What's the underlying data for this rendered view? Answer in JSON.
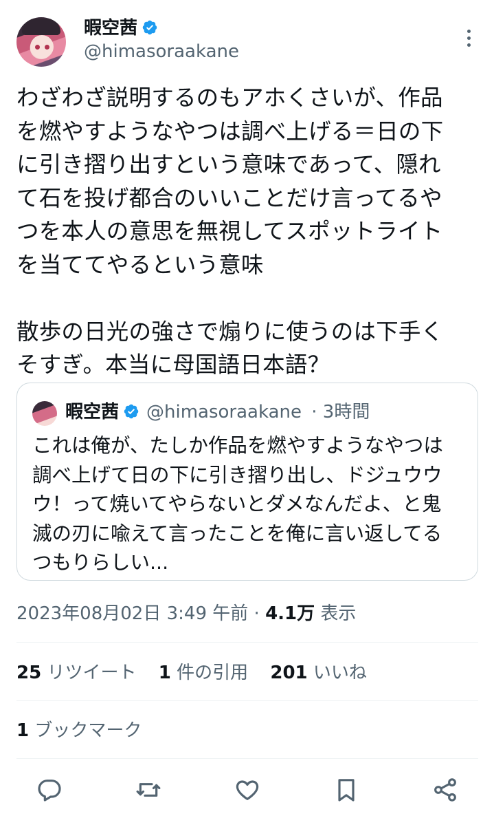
{
  "author": {
    "display_name": "暇空茜",
    "handle": "@himasoraakane",
    "verified_badge_color": "#1d9bf0",
    "avatar_icon": "anime-girl-avatar"
  },
  "tweet": {
    "text": "わざわざ説明するのもアホくさいが、作品\nを燃やすようなやつは調べ上げる＝日の下\nに引き摺り出すという意味であって、隠れ\nて石を投げ都合のいいことだけ言ってるや\nつを本人の意思を無視してスポットライト\nを当ててやるという意味\n\n散歩の日光の強さで煽りに使うのは下手く\nそすぎ。本当に母国語日本語？"
  },
  "quoted_tweet": {
    "display_name": "暇空茜",
    "handle": "@himasoraakane",
    "time": "· 3時間",
    "text": "これは俺が、たしか作品を燃やすようなやつは\n調べ上げて日の下に引き摺り出し、ドジュウウ\nウ！って焼いてやらないとダメなんだよ、と鬼\n滅の刃に喩えて言ったことを俺に言い返してる\nつもりらしい..."
  },
  "meta": {
    "timestamp": "2023年08月02日 3:49 午前",
    "separator": "·",
    "views_count": "4.1万",
    "views_label": "表示"
  },
  "stats": {
    "retweets_count": "25",
    "retweets_label": "リツイート",
    "quotes_count": "1",
    "quotes_label": "件の引用",
    "likes_count": "201",
    "likes_label": "いいね"
  },
  "bookmarks": {
    "count": "1",
    "label": "ブックマーク"
  },
  "actions": [
    "reply-icon",
    "retweet-icon",
    "like-icon",
    "bookmark-icon",
    "share-icon"
  ],
  "colors": {
    "text": "#0f1419",
    "secondary": "#536471",
    "border": "#cfd9de"
  }
}
